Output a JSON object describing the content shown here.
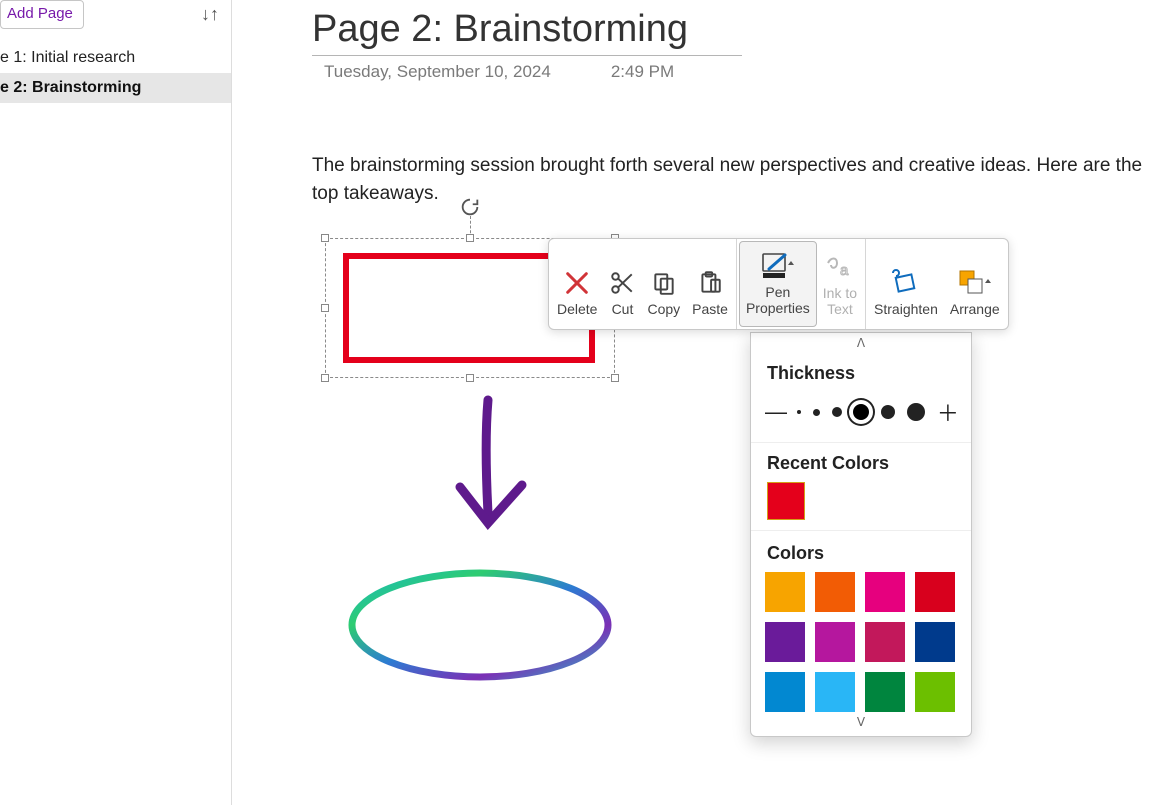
{
  "sidebar": {
    "add_page_label": "Add Page",
    "pages": [
      {
        "label": "e 1: Initial research",
        "selected": false
      },
      {
        "label": "e 2: Brainstorming",
        "selected": true
      }
    ]
  },
  "page": {
    "title": "Page 2: Brainstorming",
    "date": "Tuesday, September 10, 2024",
    "time": "2:49 PM",
    "body": "The brainstorming session brought forth several new perspectives and creative ideas. Here are the top takeaways."
  },
  "mini_toolbar": {
    "delete": "Delete",
    "cut": "Cut",
    "copy": "Copy",
    "paste": "Paste",
    "pen_properties": "Pen\nProperties",
    "ink_to_text": "Ink to\nText",
    "straighten": "Straighten",
    "arrange": "Arrange"
  },
  "pen_panel": {
    "thickness_label": "Thickness",
    "recent_colors_label": "Recent Colors",
    "recent_colors": [
      "#e4001b"
    ],
    "colors_label": "Colors",
    "colors": [
      "#f7a400",
      "#f25c05",
      "#e6007e",
      "#d8001d",
      "#6a1b9a",
      "#b5179e",
      "#c2185b",
      "#003a8c",
      "#0288d1",
      "#29b6f6",
      "#00853e",
      "#6cbf00"
    ]
  },
  "ink": {
    "rect_color": "#e4001b",
    "arrow_color": "#5e1a8c"
  }
}
